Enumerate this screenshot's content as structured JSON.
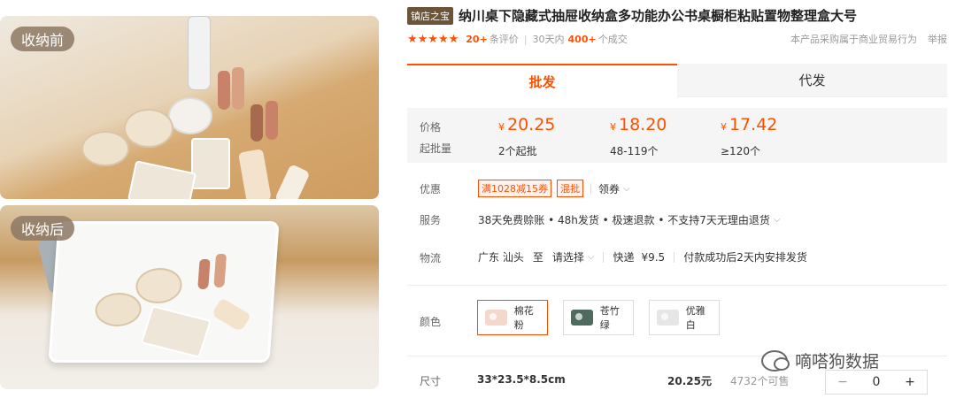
{
  "images": {
    "before_tag": "收纳前",
    "after_tag": "收纳后"
  },
  "product": {
    "shop_badge": "镇店之宝",
    "title": "纳川桌下隐藏式抽屉收纳盒多功能办公书桌橱柜粘贴置物整理盒大号",
    "stars": "★★★★★",
    "review_count": "20+",
    "review_label": "条评价",
    "sales_period": "30天内",
    "sales_count": "400+",
    "sales_label": "个成交",
    "trade_note": "本产品采购属于商业贸易行为",
    "report": "举报"
  },
  "tabs": [
    {
      "label": "批发"
    },
    {
      "label": "代发"
    }
  ],
  "price_box": {
    "price_label": "价格",
    "qty_label": "起批量",
    "currency": "¥",
    "tiers": [
      {
        "price": "20.25",
        "qty": "2个起批"
      },
      {
        "price": "18.20",
        "qty": "48-119个"
      },
      {
        "price": "17.42",
        "qty": "≥120个"
      }
    ]
  },
  "promo": {
    "label": "优惠",
    "coupon1": "满1028减15券",
    "coupon2": "混批",
    "get_coupon": "领券"
  },
  "service": {
    "label": "服务",
    "text": "38天免费赊账 • 48h发货 • 极速退款 • 不支持7天无理由退货"
  },
  "logistics": {
    "label": "物流",
    "from": "广东 汕头",
    "to_word": "至",
    "select": "请选择",
    "express": "快递",
    "fee": "¥9.5",
    "note": "付款成功后2天内安排发货"
  },
  "colors": {
    "label": "颜色",
    "options": [
      {
        "name": "棉花粉",
        "swatch": "#f3d9cc"
      },
      {
        "name": "苍竹绿",
        "swatch": "#4f6a5e"
      },
      {
        "name": "优雅白",
        "swatch": "#e6e6e6"
      }
    ]
  },
  "size": {
    "label": "尺寸",
    "value": "33*23.5*8.5cm",
    "price": "20.25元",
    "stock": "4732个可售",
    "minus": "−",
    "count": "0",
    "plus": "+"
  },
  "watermark": "嘀嗒狗数据"
}
